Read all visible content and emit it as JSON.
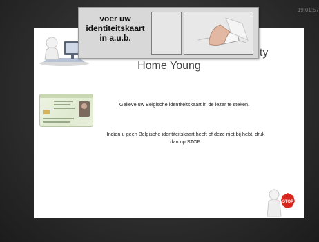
{
  "clock": {
    "time": "19:01:57"
  },
  "screen": {
    "title": "Home Young",
    "title_tail": "uty",
    "message_insert": "Gelieve uw Belgische identiteitskaart in de lezer te steken.",
    "message_stop": "Indien u geen Belgische identiteitskaart heeft of deze niet bij hebt, druk dan op STOP."
  },
  "tooltip": {
    "line1": "voer uw",
    "line2": "identiteitskaart",
    "line3": "in a.u.b."
  },
  "stop_button": {
    "label": "STOP",
    "color": "#d8261e"
  },
  "icons": {
    "figure": "person-at-computer-icon",
    "idcard": "belgian-id-card-icon",
    "stop": "stop-sign-icon"
  }
}
